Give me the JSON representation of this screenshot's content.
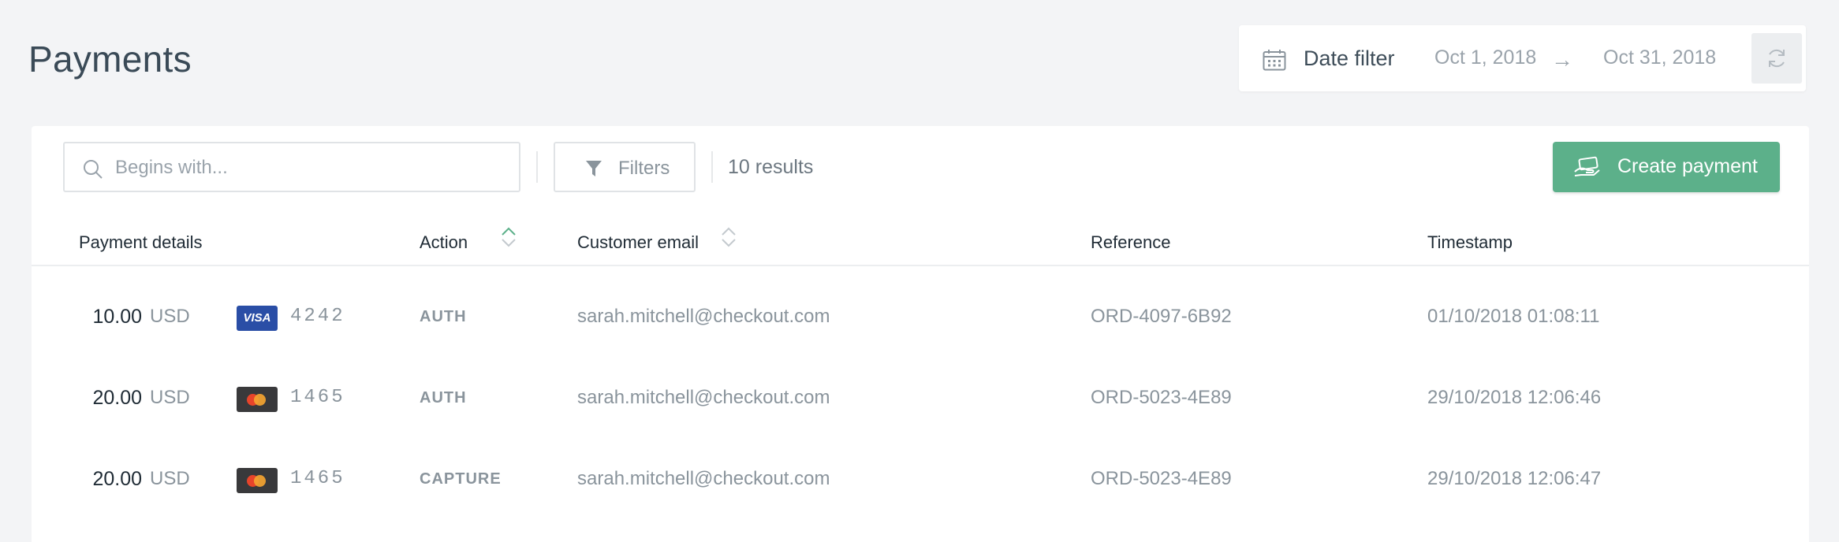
{
  "header": {
    "title": "Payments"
  },
  "date_filter": {
    "label": "Date filter",
    "from": "Oct 1, 2018",
    "arrow": "→",
    "to": "Oct 31, 2018"
  },
  "toolbar": {
    "search_placeholder": "Begins with...",
    "filters_label": "Filters",
    "results_text": "10 results",
    "create_label": "Create payment"
  },
  "table": {
    "columns": [
      "Payment details",
      "Action",
      "Customer email",
      "Reference",
      "Timestamp"
    ],
    "rows": [
      {
        "amount": "10.00",
        "currency": "USD",
        "card": "VISA",
        "card_type": "visa",
        "last4": "4242",
        "action": "AUTH",
        "email": "sarah.mitchell@checkout.com",
        "reference": "ORD-4097-6B92",
        "timestamp": "01/10/2018 01:08:11"
      },
      {
        "amount": "20.00",
        "currency": "USD",
        "card": "",
        "card_type": "mastercard",
        "last4": "1465",
        "action": "AUTH",
        "email": "sarah.mitchell@checkout.com",
        "reference": "ORD-5023-4E89",
        "timestamp": "29/10/2018 12:06:46"
      },
      {
        "amount": "20.00",
        "currency": "USD",
        "card": "",
        "card_type": "mastercard",
        "last4": "1465",
        "action": "CAPTURE",
        "email": "sarah.mitchell@checkout.com",
        "reference": "ORD-5023-4E89",
        "timestamp": "29/10/2018 12:06:47"
      }
    ]
  },
  "colors": {
    "accent": "#5cb08a",
    "visa": "#2a4ea6",
    "mastercard_bg": "#39393b",
    "mastercard_red": "#e8442a",
    "mastercard_orange": "#f4a431"
  },
  "icons": [
    "calendar-icon",
    "refresh-icon",
    "search-icon",
    "filter-icon",
    "payment-hand-icon",
    "sort-icon",
    "visa-card-icon",
    "mastercard-card-icon"
  ]
}
